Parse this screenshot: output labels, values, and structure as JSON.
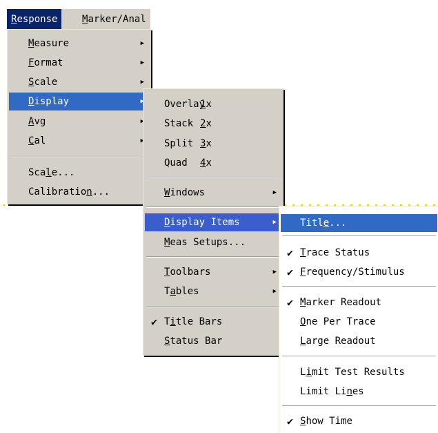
{
  "menubar": {
    "items": [
      "Response",
      "Marker/Anal"
    ]
  },
  "response_menu": {
    "items": [
      "Measure",
      "Format",
      "Scale",
      "Display",
      "Avg",
      "Cal"
    ],
    "items2": [
      "Scale...",
      "Calibration..."
    ]
  },
  "display_menu": {
    "layout": [
      {
        "label": "Overlay",
        "acc": "1x"
      },
      {
        "label": "Stack",
        "acc": "2x"
      },
      {
        "label": "Split",
        "acc": "3x"
      },
      {
        "label": "Quad",
        "acc": "4x"
      }
    ],
    "windows": "Windows",
    "display_items": "Display Items",
    "meas_setups": "Meas Setups...",
    "toolbars": "Toolbars",
    "tables": "Tables",
    "title_bars": "Title Bars",
    "status_bar": "Status Bar"
  },
  "display_items_menu": {
    "title": "Title...",
    "trace_status": "Trace Status",
    "frequency_stimulus": "Frequency/Stimulus",
    "marker_readout": "Marker Readout",
    "one_per_trace": "One Per Trace",
    "large_readout": "Large Readout",
    "limit_test_results": "Limit Test Results",
    "limit_lines": "Limit Lines",
    "show_time": "Show Time"
  },
  "icons": {
    "submenu_arrow": "triangle-right",
    "checked": "check-mark"
  },
  "colors": {
    "menu_bg": "#d4d0c8",
    "highlight": "#316ac5",
    "menubar_active": "#0a246a"
  }
}
